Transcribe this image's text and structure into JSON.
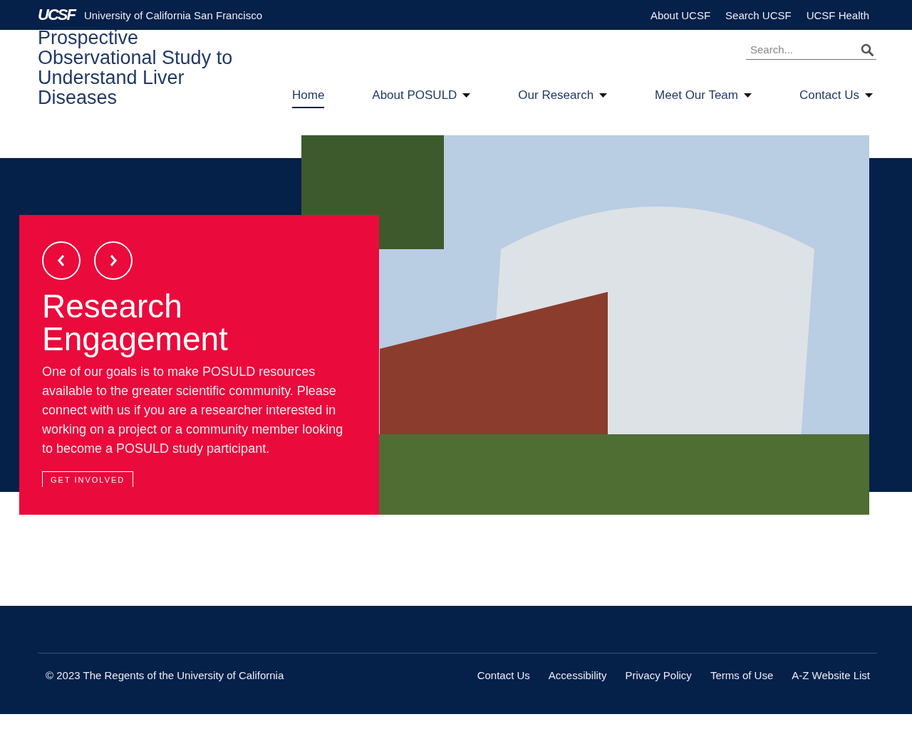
{
  "top_bar": {
    "logo": "UCSF",
    "university": "University of California San Francisco",
    "links": [
      "About UCSF",
      "Search UCSF",
      "UCSF Health"
    ]
  },
  "site_title": "Prospective Observational Study to Understand Liver Diseases",
  "search": {
    "placeholder": "Search..."
  },
  "nav": [
    {
      "label": "Home",
      "selected": true,
      "has_menu": false
    },
    {
      "label": "About POSULD",
      "selected": false,
      "has_menu": true
    },
    {
      "label": "Our Research",
      "selected": false,
      "has_menu": true
    },
    {
      "label": "Meet Our Team",
      "selected": false,
      "has_menu": true
    },
    {
      "label": "Contact Us",
      "selected": false,
      "has_menu": true
    }
  ],
  "hero": {
    "heading": "Research Engagement",
    "text": "One of our goals is to make POSULD resources available to the greater scientific community. Please connect with us if you are a researcher interested in working on a project or a community member looking to become a POSULD study participant.",
    "button": "GET INVOLVED"
  },
  "footer": {
    "copyright": "© 2023 The Regents of the University of California",
    "links": [
      "Contact Us",
      "Accessibility",
      "Privacy Policy",
      "Terms of Use",
      "A-Z Website List"
    ]
  }
}
